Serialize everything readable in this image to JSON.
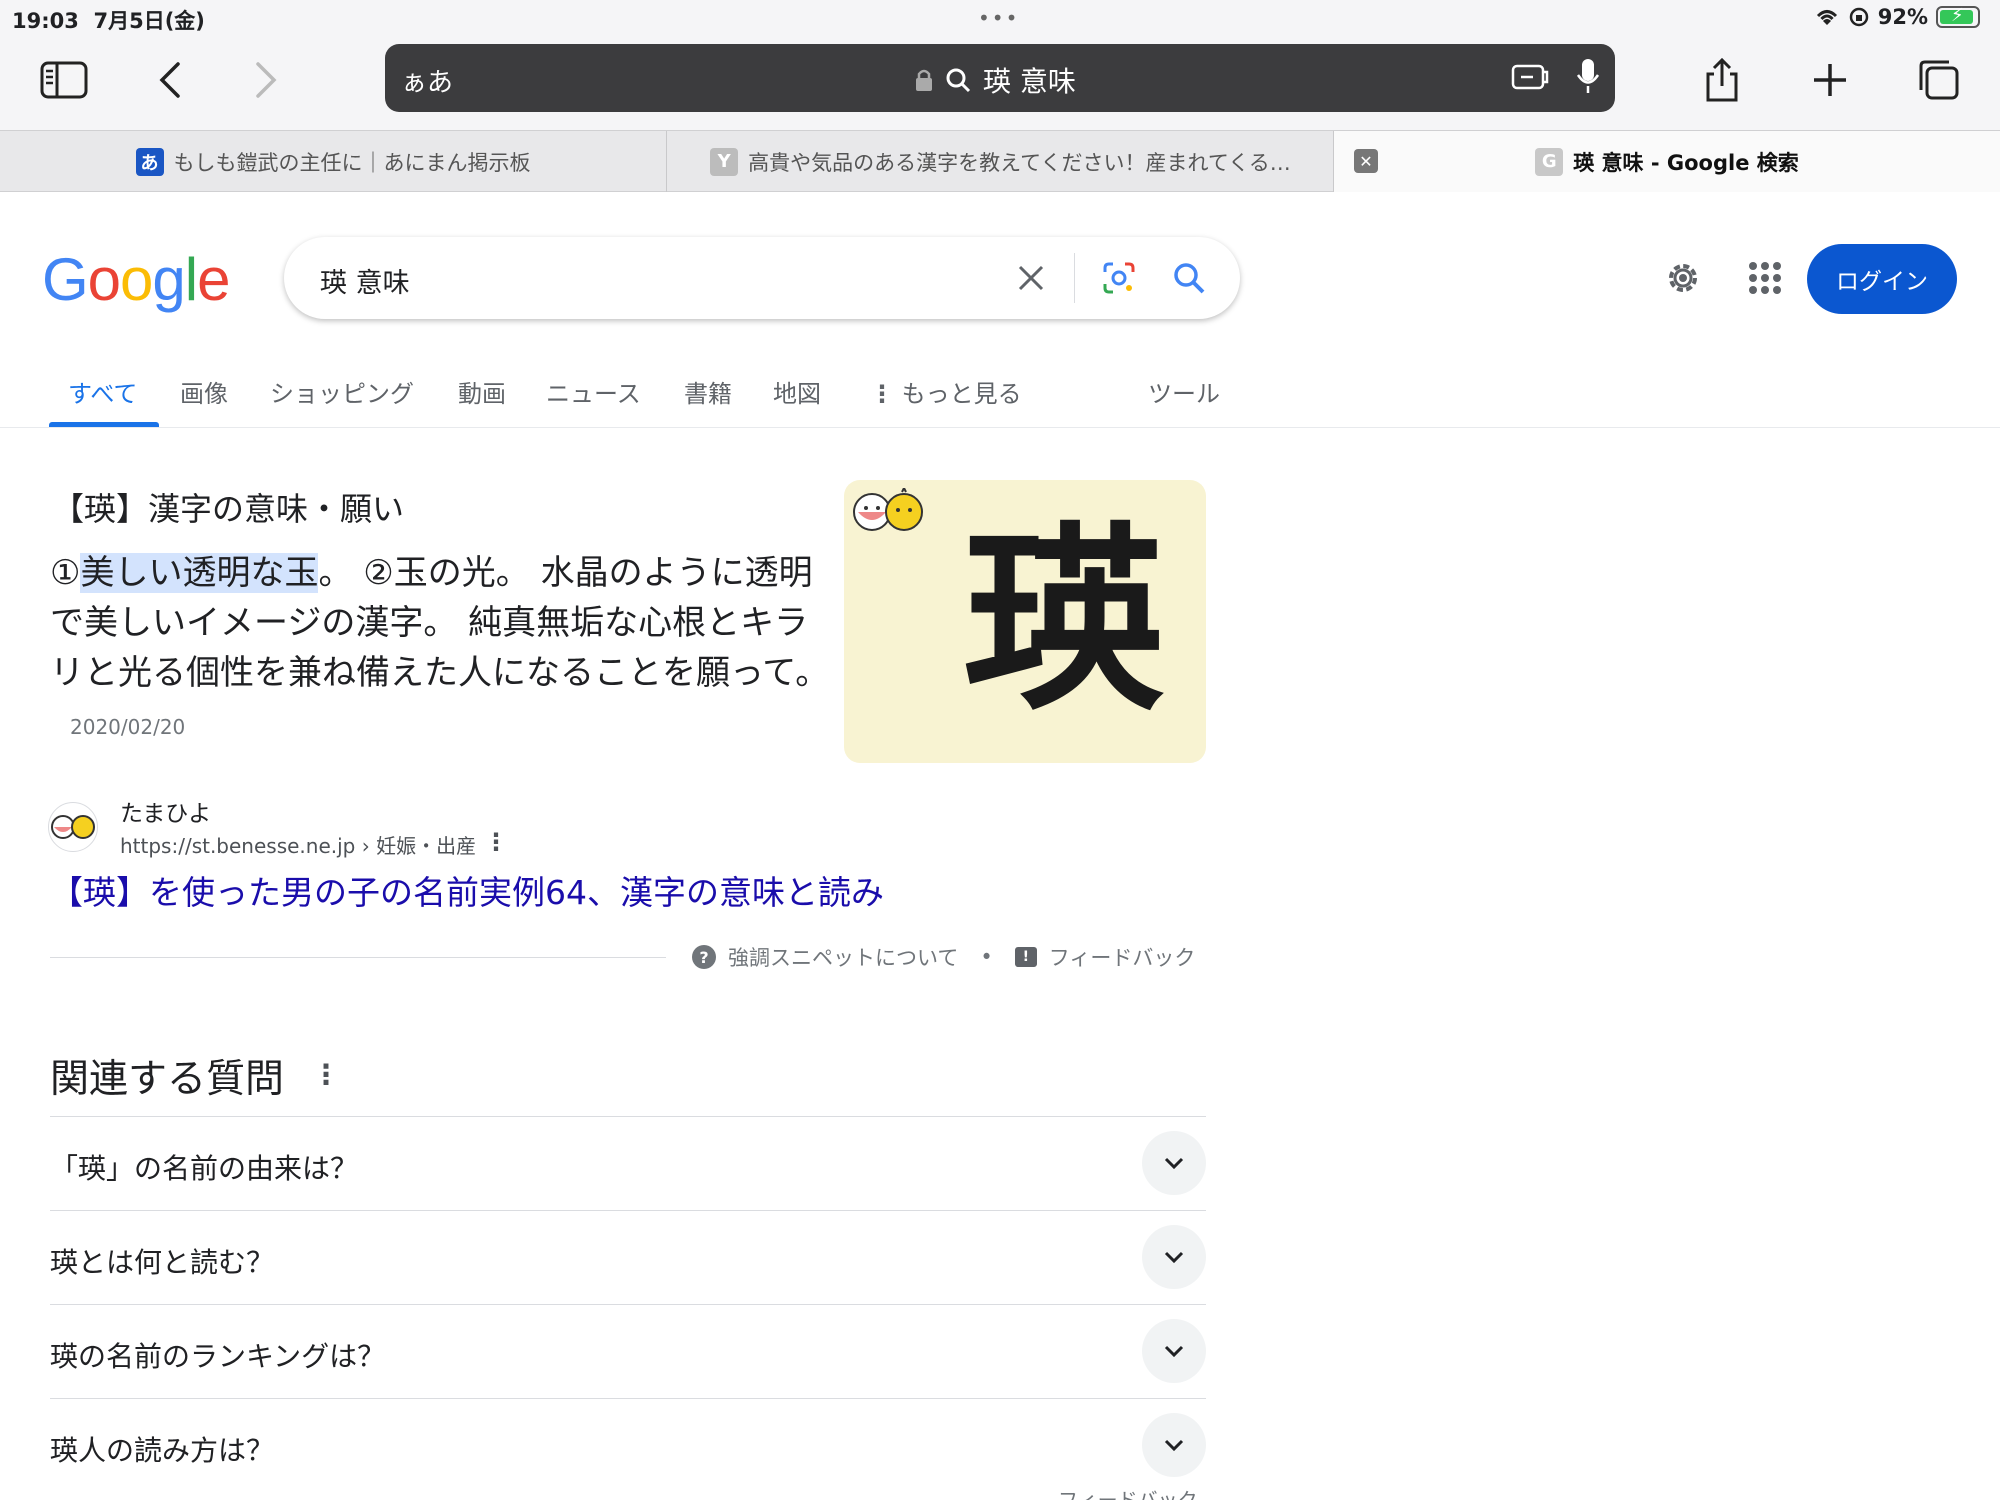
{
  "status_bar": {
    "time": "19:03",
    "date": "7月5日(金)",
    "battery": "92%",
    "battery_level": 0.92
  },
  "toolbar": {
    "url_aa": "ぁあ",
    "url_text": "瑛 意味"
  },
  "tabs": [
    {
      "favicon": "あ",
      "favicon_color": "#1a56c4",
      "title": "もしも鎧武の主任に｜あにまん掲示板"
    },
    {
      "favicon": "Y",
      "favicon_color": "#bcbcbc",
      "title": "高貴や気品のある漢字を教えてください！産まれてくる…"
    },
    {
      "favicon": "G",
      "favicon_color": "#c8c8c8",
      "title": "瑛 意味 - Google 検索"
    }
  ],
  "google": {
    "logo": [
      "G",
      "o",
      "o",
      "g",
      "l",
      "e"
    ],
    "logo_colors": [
      "#4285f4",
      "#ea4335",
      "#fbbc05",
      "#4285f4",
      "#34a853",
      "#ea4335"
    ],
    "search_value": "瑛 意味",
    "login_label": "ログイン"
  },
  "nav": {
    "items": [
      "すべて",
      "画像",
      "ショッピング",
      "動画",
      "ニュース",
      "書籍",
      "地図",
      "もっと見る",
      "ツール"
    ],
    "active_index": 0
  },
  "snippet": {
    "heading": "【瑛】漢字の意味・願い",
    "body_prefix": "①",
    "body_highlight": "美しい透明な玉",
    "body_rest": "。 ②玉の光。 水晶のように透明で美しいイメージの漢字。 純真無垢な心根とキラリと光る個性を兼ね備えた人になることを願って。",
    "date": "2020/02/20",
    "image_kanji": "瑛",
    "source_name": "たまひよ",
    "source_url": "https://st.benesse.ne.jp › 妊娠・出産",
    "result_title": "【瑛】を使った男の子の名前実例64、漢字の意味と読み",
    "footer_about": "強調スニペットについて",
    "footer_sep": "•",
    "footer_feedback": "フィードバック"
  },
  "related": {
    "title": "関連する質問",
    "questions": [
      "「瑛」の名前の由来は？",
      "瑛とは何と読む？",
      "瑛の名前のランキングは？",
      "瑛人の読み方は？"
    ],
    "footer": "フィードバック"
  },
  "colors": {
    "link": "#1a0dab",
    "accent": "#1a73e8",
    "login": "#0b57d0"
  }
}
